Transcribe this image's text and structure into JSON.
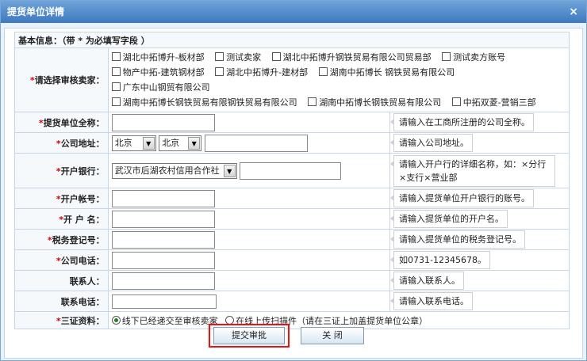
{
  "window": {
    "title": "提货单位详情",
    "close_glyph": "×"
  },
  "form": {
    "section_header": "基本信息：（带 * 为必填写字段 ）",
    "required_mark": "*",
    "sellers": {
      "label": "请选择审核卖家：",
      "options": [
        "湖北中拓博升-板材部",
        "测试卖家",
        "湖北中拓博升钢铁贸易有限公司贸易部",
        "测试卖方账号",
        "物产中拓-建筑钢材部",
        "湖北中拓博升-建材部",
        "湖南中拓博长 钢铁贸易有限公司",
        "广东中山钢贸有限公司",
        "湖南中拓博长钢铁贸易有限钢铁贸易有限公司",
        "湖南中拓博长钢铁贸易有限公司",
        "中拓双菱-营销三部"
      ]
    },
    "company_name": {
      "label": "提货单位全称：",
      "value": "",
      "hint": "请输入在工商所注册的公司全称。"
    },
    "address": {
      "label": "公司地址：",
      "province": "北京",
      "city": "北京",
      "detail": "",
      "hint": "请输入公司地址。"
    },
    "bank": {
      "label": "开户银行：",
      "selected": "武汉市后湖农村信用合作社",
      "branch": "",
      "hint": "请输入开户行的详细名称，如：×分行×支行×营业部"
    },
    "account": {
      "label": "开户帐号：",
      "value": "",
      "hint": "请输入提货单位开户银行的账号。"
    },
    "account_name": {
      "label": "开 户 名：",
      "value": "",
      "hint": "请输入提货单位的开户名。"
    },
    "tax_no": {
      "label": "税务登记号：",
      "value": "",
      "hint": "请输入提货单位的税务登记号。"
    },
    "phone": {
      "label": "公司电话：",
      "value": "",
      "hint": "如0731-12345678。"
    },
    "contact": {
      "label": "联系人：",
      "value": "",
      "hint": "请输入联系人。"
    },
    "contact_phone": {
      "label": "联系电话：",
      "value": "",
      "hint": "请输入联系电话。"
    },
    "certs": {
      "label": "三证资料：",
      "option_offline": "线下已经递交至审核卖家",
      "option_online": "在线上传扫描件（请在三证上加盖提货单位公章）",
      "selected": "offline"
    }
  },
  "buttons": {
    "submit": "提交审批",
    "close": "关 闭"
  },
  "colors": {
    "title_bar": "#4f8bcb",
    "required": "#d40000",
    "highlight": "#e11111"
  }
}
